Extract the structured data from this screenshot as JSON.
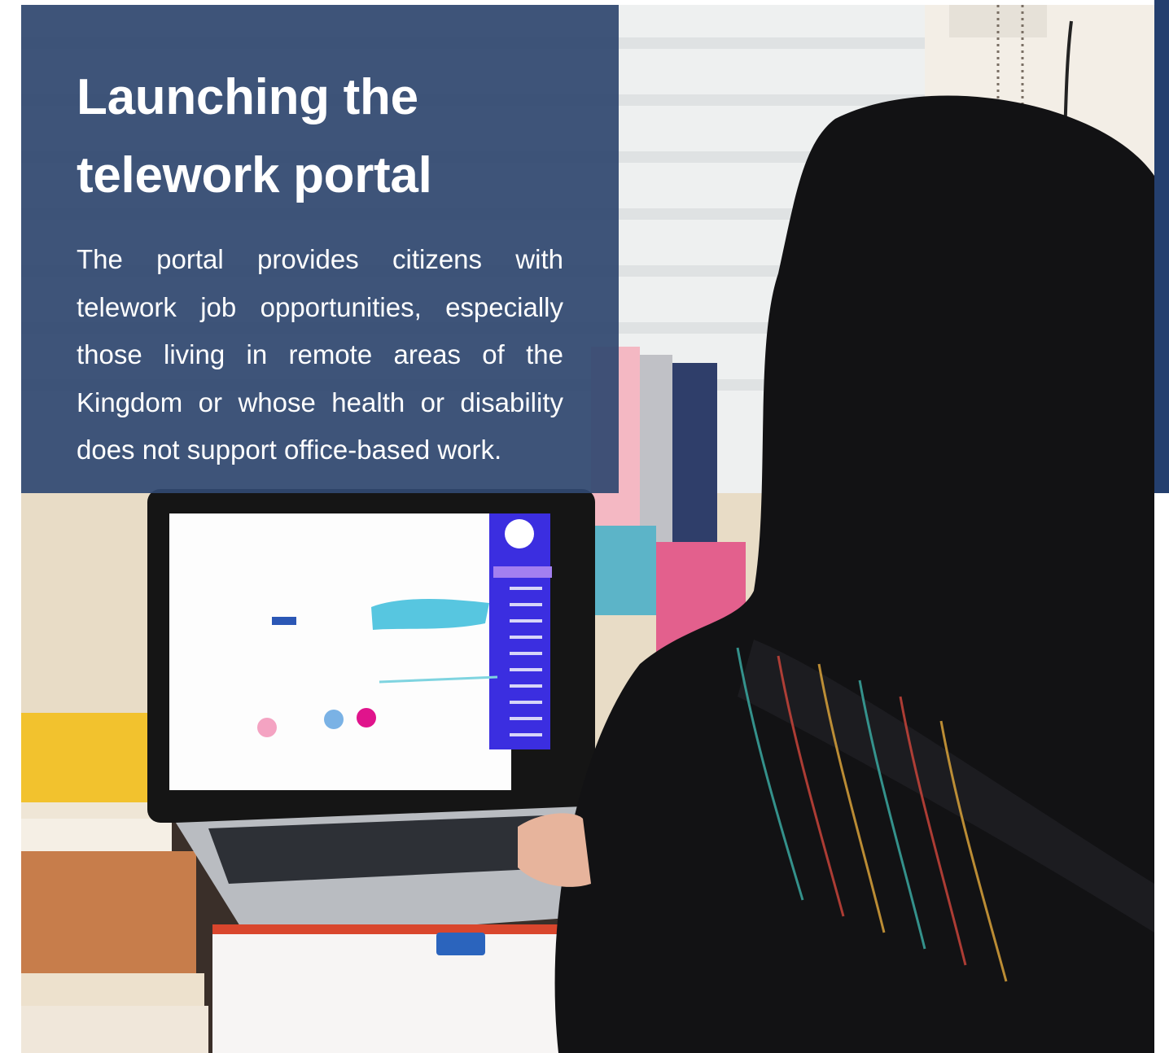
{
  "article": {
    "title_line1": "Launching the",
    "title_line2": "telework portal",
    "body": "The portal provides citizens with telework job opportunities, especially those living in remote areas of the Kingdom or whose health or disability does not support office-based work."
  },
  "colors": {
    "panel": "#304870",
    "accent_strip": "#243f6e",
    "text": "#ffffff"
  }
}
